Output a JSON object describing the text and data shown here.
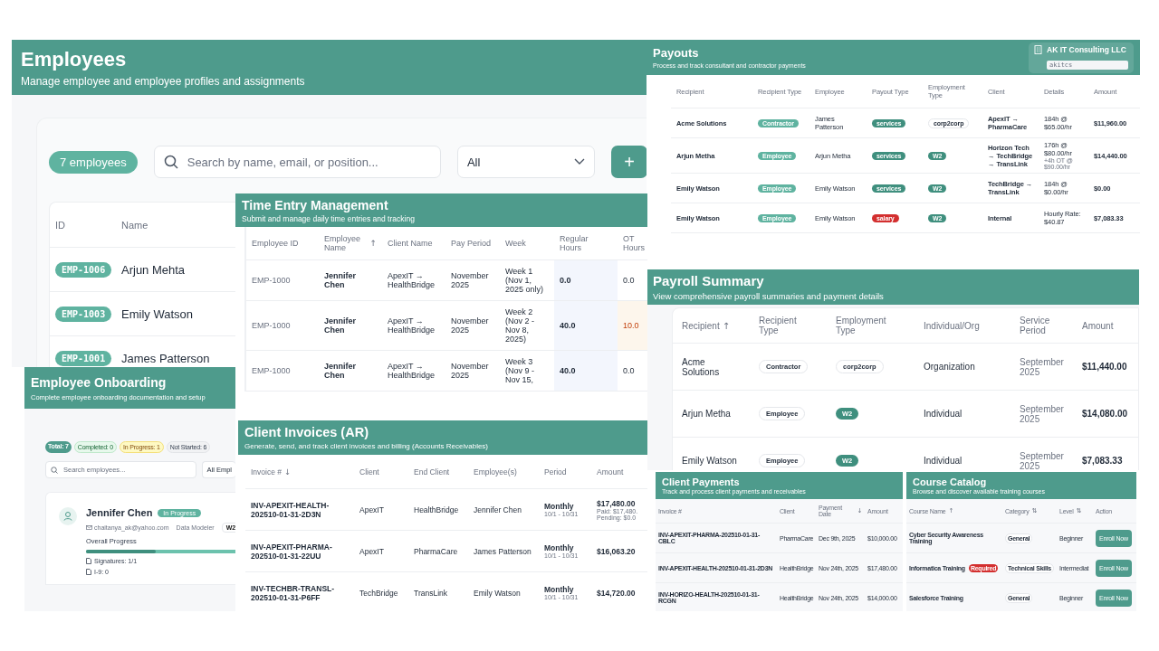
{
  "employees": {
    "title": "Employees",
    "subtitle": "Manage employee and employee profiles and assignments",
    "count_badge": "7 employees",
    "search": {
      "placeholder": "Search by name, email, or position..."
    },
    "filter": {
      "value": "All"
    },
    "add_button": "+",
    "columns": [
      "ID",
      "Name"
    ],
    "rows": [
      {
        "id": "EMP-1006",
        "name": "Arjun Mehta"
      },
      {
        "id": "EMP-1003",
        "name": "Emily Watson"
      },
      {
        "id": "EMP-1001",
        "name": "James Patterson"
      }
    ]
  },
  "time_entry": {
    "title": "Time Entry Management",
    "subtitle": "Submit and manage daily time entries and tracking",
    "columns": [
      {
        "label": "Employee ID"
      },
      {
        "label": "Employee Name",
        "sort": "↑"
      },
      {
        "label": "Client Name"
      },
      {
        "label": "Pay Period"
      },
      {
        "label": "Week"
      },
      {
        "label": "Regular Hours"
      },
      {
        "label": "OT Hours"
      }
    ],
    "rows": [
      {
        "employee_id": "EMP-1000",
        "employee_name": "Jennifer Chen",
        "client_name": "ApexIT → HealthBridge",
        "pay_period": "November 2025",
        "week": "Week 1 (Nov 1, 2025 only)",
        "regular_hours": "0.0",
        "ot_hours": "0.0",
        "ot_flagged": false
      },
      {
        "employee_id": "EMP-1000",
        "employee_name": "Jennifer Chen",
        "client_name": "ApexIT → HealthBridge",
        "pay_period": "November 2025",
        "week": "Week 2 (Nov 2 - Nov 8, 2025)",
        "regular_hours": "40.0",
        "ot_hours": "10.0",
        "ot_flagged": true
      },
      {
        "employee_id": "EMP-1000",
        "employee_name": "Jennifer Chen",
        "client_name": "ApexIT → HealthBridge",
        "pay_period": "November 2025",
        "week": "Week 3 (Nov 9 - Nov 15,",
        "regular_hours": "40.0",
        "ot_hours": "0.0",
        "ot_flagged": false
      }
    ]
  },
  "onboarding": {
    "title": "Employee Onboarding",
    "subtitle": "Complete employee onboarding documentation and setup",
    "stats": [
      {
        "label": "Total: 7",
        "kind": "total"
      },
      {
        "label": "Completed: 0",
        "kind": "completed"
      },
      {
        "label": "In Progress: 1",
        "kind": "progress"
      },
      {
        "label": "Not Started: 6",
        "kind": "neutral"
      }
    ],
    "search": {
      "placeholder": "Search employees..."
    },
    "filter": {
      "value": "All Empl"
    },
    "card": {
      "name": "Jennifer Chen",
      "status": "In Progress",
      "email": "chaitanya_ak@yahoo.com",
      "role": "Data Modeler",
      "type": "W2",
      "progress_label": "Overall Progress",
      "level": 0.45,
      "items": [
        "Signatures: 1/1",
        "I-9: 0"
      ]
    }
  },
  "invoices": {
    "title": "Client Invoices (AR)",
    "subtitle": "Generate, send, and track client invoices and billing (Accounts Receivables)",
    "columns": [
      {
        "label": "Invoice #",
        "sort": "↓"
      },
      {
        "label": "Client"
      },
      {
        "label": "End Client"
      },
      {
        "label": "Employee(s)"
      },
      {
        "label": "Period"
      },
      {
        "label": "Amount"
      }
    ],
    "rows": [
      {
        "invoice": "INV-APEXIT-HEALTH-202510-01-31-2D3N",
        "client": "ApexIT",
        "end_client": "HealthBridge",
        "employees": "Jennifer Chen",
        "period": "Monthly",
        "range": "10/1 - 10/31",
        "amount": "$17,480.00",
        "paid": "Paid: $17,480.",
        "pending": "Pending: $0.0"
      },
      {
        "invoice": "INV-APEXIT-PHARMA-202510-01-31-22UU",
        "client": "ApexIT",
        "end_client": "PharmaCare",
        "employees": "James Patterson",
        "period": "Monthly",
        "range": "10/1 - 10/31",
        "amount": "$16,063.20"
      },
      {
        "invoice": "INV-TECHBR-TRANSL-202510-01-31-P6FF",
        "client": "TechBridge",
        "end_client": "TransLink",
        "employees": "Emily Watson",
        "period": "Monthly",
        "range": "10/1 - 10/31",
        "amount": "$14,720.00"
      }
    ]
  },
  "payouts": {
    "title": "Payouts",
    "subtitle": "Process and track consultant and contractor payments",
    "company": {
      "name": "AK IT Consulting LLC",
      "code": "akitcs"
    },
    "columns": [
      {
        "label": "Recipient"
      },
      {
        "label": "Recipient Type"
      },
      {
        "label": "Employee"
      },
      {
        "label": "Payout Type"
      },
      {
        "label": "Employment Type"
      },
      {
        "label": "Client"
      },
      {
        "label": "Details"
      },
      {
        "label": "Amount"
      }
    ],
    "rows": [
      {
        "recipient": "Acme Solutions",
        "recipient_type": {
          "text": "Contractor",
          "kind": "soft"
        },
        "employee": "James Patterson",
        "payout_type": {
          "text": "services",
          "kind": "solid"
        },
        "employment_type": {
          "text": "corp2corp",
          "kind": "outline"
        },
        "client": "ApexIT → PharmaCare",
        "details": "184h @ $65.00/hr",
        "amount": "$11,960.00"
      },
      {
        "recipient": "Arjun Metha",
        "recipient_type": {
          "text": "Employee",
          "kind": "soft"
        },
        "employee": "Arjun Metha",
        "payout_type": {
          "text": "services",
          "kind": "solid"
        },
        "employment_type": {
          "text": "W2",
          "kind": "solid"
        },
        "client": "Horizon Tech → TechBridge → TransLink",
        "details": "176h @ $80.00/hr",
        "details_extra": "+4h OT @ $90.00/hr",
        "amount": "$14,440.00"
      },
      {
        "recipient": "Emily Watson",
        "recipient_type": {
          "text": "Employee",
          "kind": "soft"
        },
        "employee": "Emily Watson",
        "payout_type": {
          "text": "services",
          "kind": "solid"
        },
        "employment_type": {
          "text": "W2",
          "kind": "solid"
        },
        "client": "TechBridge → TransLink",
        "details": "184h @ $0.00/hr",
        "amount": "$0.00"
      },
      {
        "recipient": "Emily Watson",
        "recipient_type": {
          "text": "Employee",
          "kind": "soft"
        },
        "employee": "Emily Watson",
        "payout_type": {
          "text": "salary",
          "kind": "danger"
        },
        "employment_type": {
          "text": "W2",
          "kind": "solid"
        },
        "client": "Internal",
        "details": "Hourly Rate: $40.87",
        "amount": "$7,083.33"
      }
    ]
  },
  "payroll": {
    "title": "Payroll Summary",
    "subtitle": "View comprehensive payroll summaries and payment details",
    "columns": [
      {
        "label": "Recipient",
        "sort": "↑"
      },
      {
        "label": "Recipient Type"
      },
      {
        "label": "Employment Type"
      },
      {
        "label": "Individual/Org"
      },
      {
        "label": "Service Period"
      },
      {
        "label": "Amount"
      }
    ],
    "rows": [
      {
        "recipient": "Acme Solutions",
        "recipient_type": {
          "text": "Contractor",
          "kind": "outline"
        },
        "employment_type": {
          "text": "corp2corp",
          "kind": "outline"
        },
        "individual_org": "Organization",
        "service_period": "September 2025",
        "amount": "$11,440.00"
      },
      {
        "recipient": "Arjun Metha",
        "recipient_type": {
          "text": "Employee",
          "kind": "outline"
        },
        "employment_type": {
          "text": "W2",
          "kind": "solid"
        },
        "individual_org": "Individual",
        "service_period": "September 2025",
        "amount": "$14,080.00"
      },
      {
        "recipient": "Emily Watson",
        "recipient_type": {
          "text": "Employee",
          "kind": "outline"
        },
        "employment_type": {
          "text": "W2",
          "kind": "solid"
        },
        "individual_org": "Individual",
        "service_period": "September 2025",
        "amount": "$7,083.33"
      }
    ]
  },
  "client_payments": {
    "title": "Client Payments",
    "subtitle": "Track and process client payments and receivables",
    "columns": [
      {
        "label": "Invoice #"
      },
      {
        "label": "Client"
      },
      {
        "label": "Payment Date",
        "sort": "↓"
      },
      {
        "label": "Amount"
      }
    ],
    "rows": [
      {
        "invoice": "INV-APEXIT-PHARMA-202510-01-31-CBLC",
        "client": "PharmaCare",
        "date": "Dec 9th, 2025",
        "amount": "$10,000.00"
      },
      {
        "invoice": "INV-APEXIT-HEALTH-202510-01-31-2D3N",
        "client": "HealthBridge",
        "date": "Nov 24th, 2025",
        "amount": "$17,480.00"
      },
      {
        "invoice": "INV-HORIZO-HEALTH-202510-01-31-RCGN",
        "client": "HealthBridge",
        "date": "Nov 24th, 2025",
        "amount": "$14,000.00"
      }
    ]
  },
  "courses": {
    "title": "Course Catalog",
    "subtitle": "Browse and discover available training courses",
    "columns": [
      {
        "label": "Course Name",
        "sort": "↑"
      },
      {
        "label": "Category",
        "sort": "⇅"
      },
      {
        "label": "Level",
        "sort": "⇅"
      },
      {
        "label": "Action"
      }
    ],
    "rows": [
      {
        "name": "Cyber Security Awareness Training",
        "category": "General",
        "level": "Beginner",
        "action": "Enroll Now"
      },
      {
        "name": "Informatica Training",
        "badge": "Required",
        "category": "Technical Skills",
        "level": "Intermediat",
        "action": "Enroll Now"
      },
      {
        "name": "Salesforce Training",
        "category": "General",
        "level": "Beginner",
        "action": "Enroll Now"
      }
    ]
  }
}
